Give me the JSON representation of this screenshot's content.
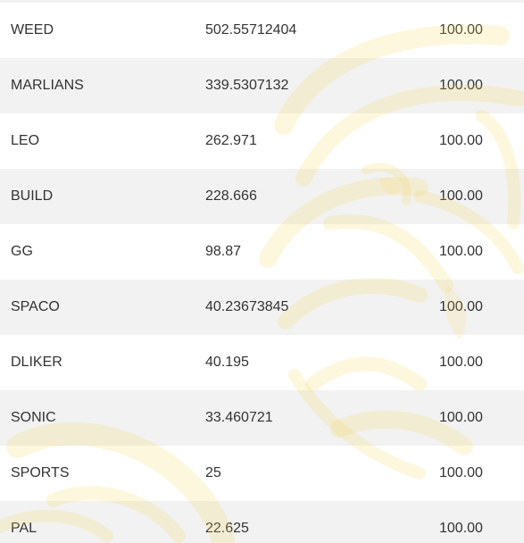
{
  "table": {
    "rows": [
      {
        "symbol": "WEED",
        "balance": "502.55712404",
        "value": "100.00"
      },
      {
        "symbol": "MARLIANS",
        "balance": "339.5307132",
        "value": "100.00"
      },
      {
        "symbol": "LEO",
        "balance": "262.971",
        "value": "100.00"
      },
      {
        "symbol": "BUILD",
        "balance": "228.666",
        "value": "100.00"
      },
      {
        "symbol": "GG",
        "balance": "98.87",
        "value": "100.00"
      },
      {
        "symbol": "SPACO",
        "balance": "40.23673845",
        "value": "100.00"
      },
      {
        "symbol": "DLIKER",
        "balance": "40.195",
        "value": "100.00"
      },
      {
        "symbol": "SONIC",
        "balance": "33.460721",
        "value": "100.00"
      },
      {
        "symbol": "SPORTS",
        "balance": "25",
        "value": "100.00"
      },
      {
        "symbol": "PAL",
        "balance": "22.625",
        "value": "100.00"
      }
    ]
  },
  "colors": {
    "text": "#333333",
    "row_alt": "#f2f2f2",
    "row_base": "#ffffff",
    "watermark": "#fbe9a8"
  },
  "icons": {
    "watermark": "lion-head-watermark-icon"
  }
}
